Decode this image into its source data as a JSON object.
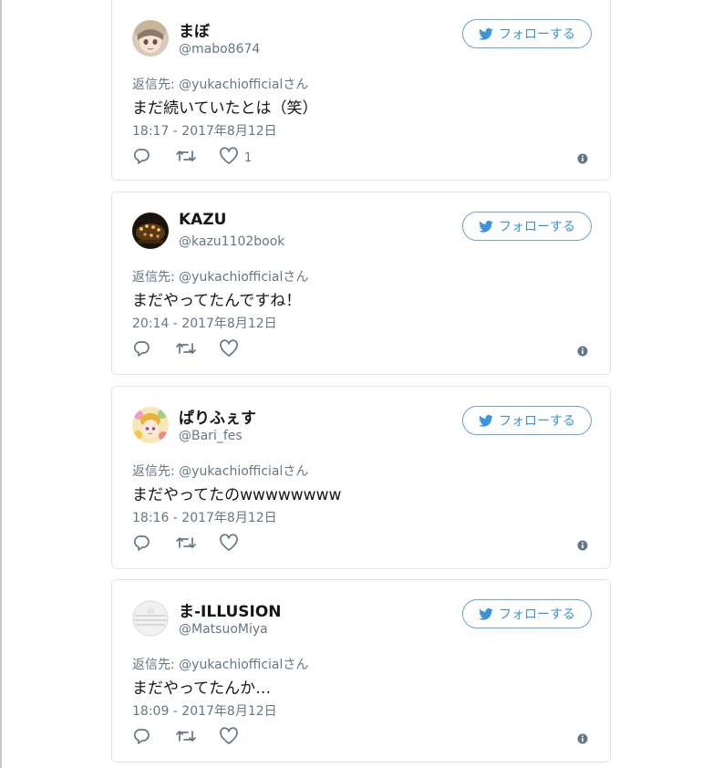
{
  "follow_label": "フォローする",
  "tweets": [
    {
      "name": "まぼ",
      "handle": "@mabo8674",
      "reply_to": "返信先: @yukachiofficialさん",
      "text": "まだ続いていたとは（笑）",
      "timestamp": "18:17 - 2017年8月12日",
      "likes": "1",
      "avatar_icon": "anime-girl-avatar"
    },
    {
      "name": "KAZU",
      "handle": "@kazu1102book",
      "reply_to": "返信先: @yukachiofficialさん",
      "text": "まだやってたんですね！",
      "timestamp": "20:14 - 2017年8月12日",
      "likes": "",
      "avatar_icon": "night-lights-avatar"
    },
    {
      "name": "ぱりふぇす",
      "handle": "@Bari_fes",
      "reply_to": "返信先: @yukachiofficialさん",
      "text": "まだやってたのwwwwwwww",
      "timestamp": "18:16 - 2017年8月12日",
      "likes": "",
      "avatar_icon": "flower-girl-avatar"
    },
    {
      "name": "ま-ILLUSION",
      "handle": "@MatsuoMiya",
      "reply_to": "返信先: @yukachiofficialさん",
      "text": "まだやってたんか…",
      "timestamp": "18:09 - 2017年8月12日",
      "likes": "",
      "avatar_icon": "default-egg-avatar"
    }
  ],
  "colors": {
    "follow_blue": "#3b94d9",
    "secondary_text": "#657786",
    "card_border": "#e1e8ed"
  }
}
